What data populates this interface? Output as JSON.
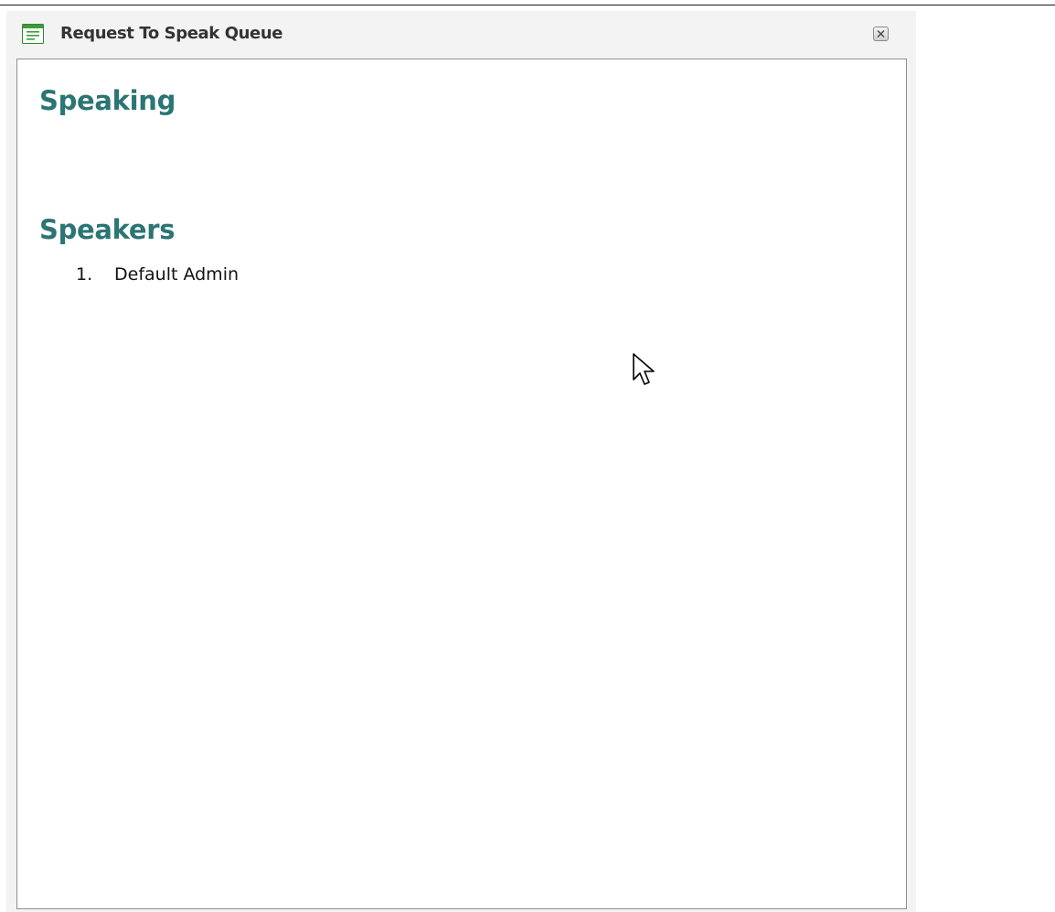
{
  "window": {
    "title": "Request To Speak Queue",
    "title_icon": "window-list-icon",
    "close_icon": "close-icon"
  },
  "sections": {
    "speaking": {
      "heading": "Speaking",
      "items": []
    },
    "speakers": {
      "heading": "Speakers",
      "items": [
        {
          "number": "1.",
          "name": "Default Admin"
        }
      ]
    }
  },
  "colors": {
    "heading": "#2b7574",
    "panel_background": "#f3f3f3",
    "icon_green": "#3f9a3f"
  },
  "pointer_icon": "mouse-pointer-icon"
}
